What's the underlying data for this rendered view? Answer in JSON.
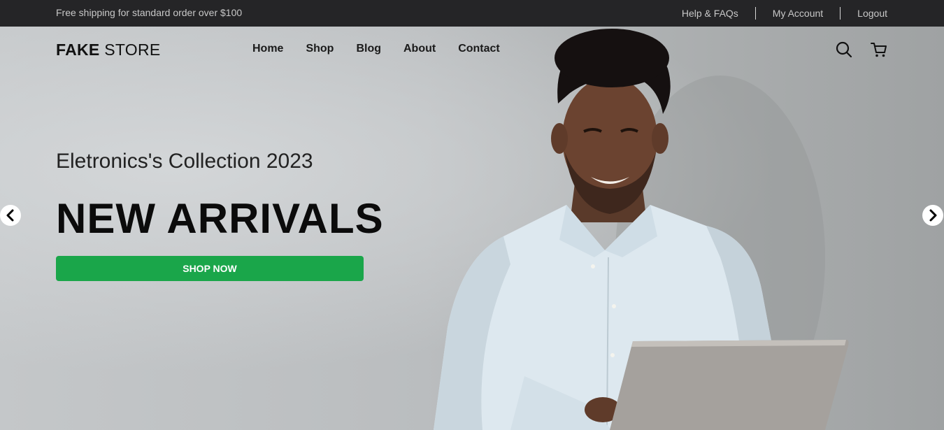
{
  "topbar": {
    "promo": "Free shipping for standard order over $100",
    "links": [
      "Help & FAQs",
      "My Account",
      "Logout"
    ]
  },
  "header": {
    "logo_bold": "FAKE",
    "logo_rest": " STORE",
    "nav": [
      "Home",
      "Shop",
      "Blog",
      "About",
      "Contact"
    ],
    "icons": [
      "search-icon",
      "cart-icon"
    ]
  },
  "hero": {
    "subtitle": "Eletronics's Collection 2023",
    "headline": "NEW ARRIVALS",
    "cta": "SHOP NOW",
    "prev_icon": "chevron-left-icon",
    "next_icon": "chevron-right-icon"
  },
  "colors": {
    "topbar_bg": "#252527",
    "cta_bg": "#1aa64a",
    "hero_bg": "#c4c7c9"
  }
}
